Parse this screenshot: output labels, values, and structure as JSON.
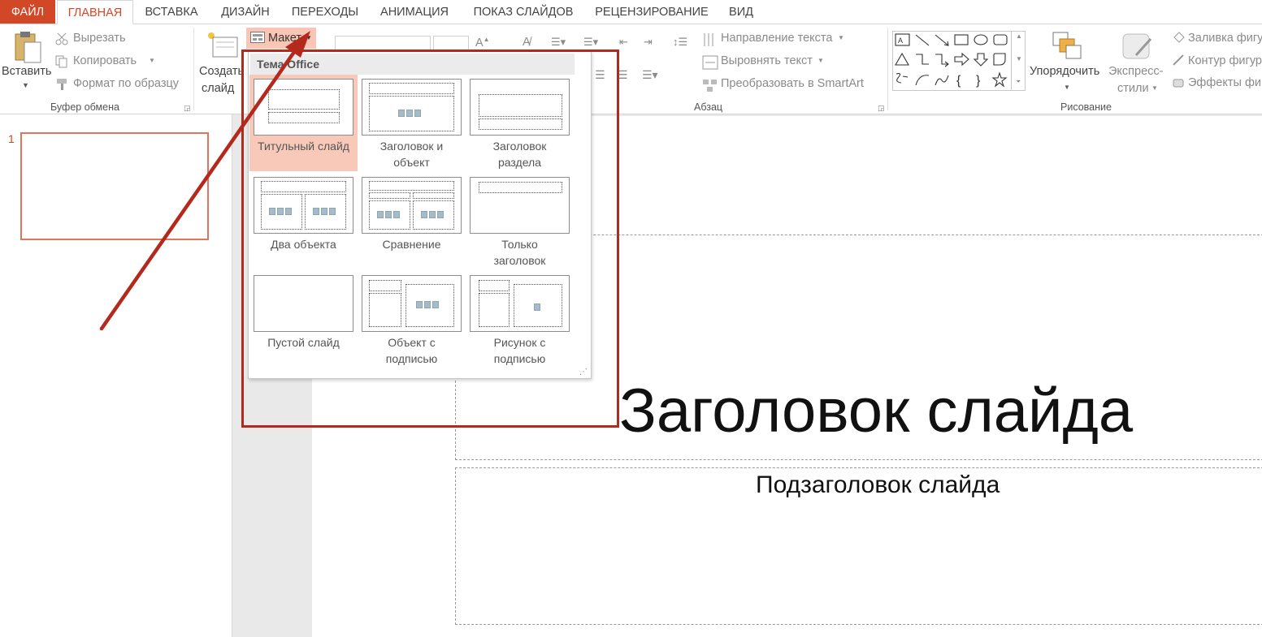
{
  "tabs": [
    {
      "label": "ФАЙЛ"
    },
    {
      "label": "ГЛАВНАЯ"
    },
    {
      "label": "ВСТАВКА"
    },
    {
      "label": "ДИЗАЙН"
    },
    {
      "label": "ПЕРЕХОДЫ"
    },
    {
      "label": "АНИМАЦИЯ"
    },
    {
      "label": "ПОКАЗ СЛАЙДОВ"
    },
    {
      "label": "РЕЦЕНЗИРОВАНИЕ"
    },
    {
      "label": "ВИД"
    }
  ],
  "clipboard": {
    "paste": "Вставить",
    "cut": "Вырезать",
    "copy": "Копировать",
    "format_painter": "Формат по образцу",
    "group_label": "Буфер обмена"
  },
  "slides": {
    "new_slide_line1": "Создать",
    "new_slide_line2": "слайд",
    "layout_button": "Макет"
  },
  "paragraph": {
    "text_direction": "Направление текста",
    "align_text": "Выровнять текст",
    "convert_smartart": "Преобразовать в SmartArt",
    "group_label": "Абзац"
  },
  "drawing": {
    "arrange": "Упорядочить",
    "quick_styles_line1": "Экспресс-",
    "quick_styles_line2": "стили",
    "shape_fill": "Заливка фигу",
    "shape_outline": "Контур фигур",
    "shape_effects": "Эффекты фиг",
    "group_label": "Рисование"
  },
  "layout_menu": {
    "header": "Тема Office",
    "layouts": [
      {
        "label": "Титульный слайд"
      },
      {
        "label": "Заголовок и\nобъект"
      },
      {
        "label": "Заголовок\nраздела"
      },
      {
        "label": "Два объекта"
      },
      {
        "label": "Сравнение"
      },
      {
        "label": "Только\nзаголовок"
      },
      {
        "label": "Пустой слайд"
      },
      {
        "label": "Объект с\nподписью"
      },
      {
        "label": "Рисунок с\nподписью"
      }
    ]
  },
  "thumbnails": {
    "slide_number": "1"
  },
  "slide": {
    "title": "Заголовок слайда",
    "subtitle": "Подзаголовок слайда"
  },
  "colors": {
    "accent": "#d24726",
    "annotation": "#b5291c",
    "selected_layout": "#f8c9b9"
  }
}
